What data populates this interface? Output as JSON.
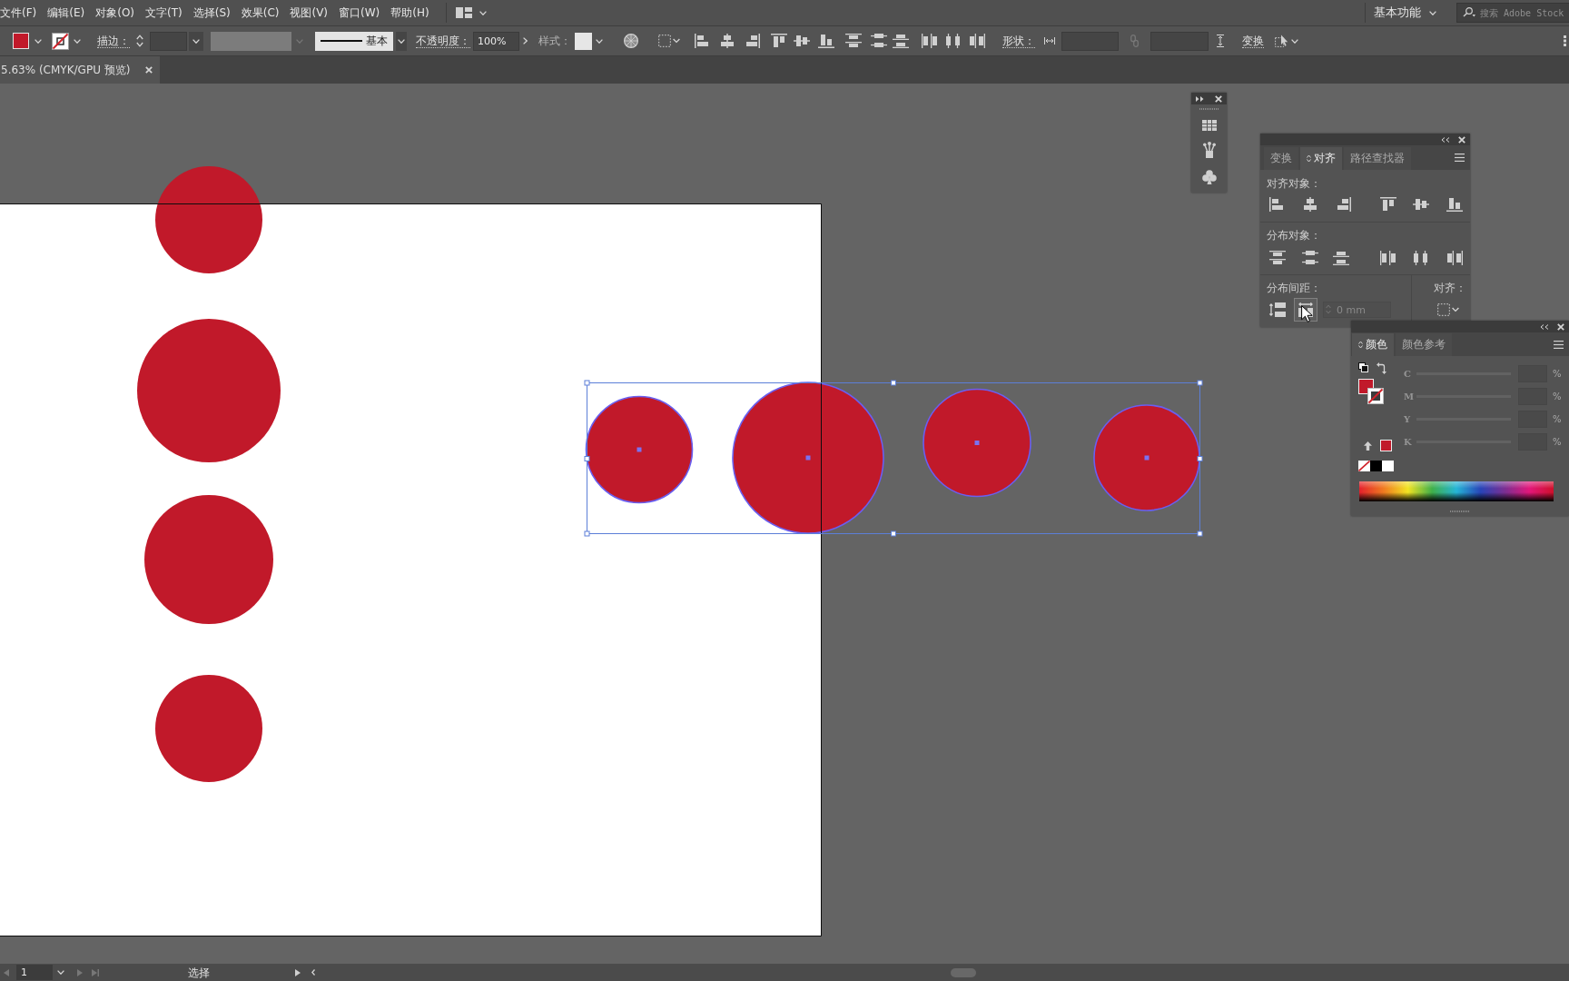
{
  "menu_bar": {
    "items": [
      "文件(F)",
      "编辑(E)",
      "对象(O)",
      "文字(T)",
      "选择(S)",
      "效果(C)",
      "视图(V)",
      "窗口(W)",
      "帮助(H)"
    ],
    "workspace": "基本功能",
    "search": {
      "placeholder": "搜索 Adobe Stock"
    }
  },
  "control_bar": {
    "stroke_label": "描边：",
    "brush": "基本",
    "opacity_label": "不透明度：",
    "opacity": "100%",
    "style_label": "样式：",
    "shape_label": "形状：",
    "transform_label": "变换"
  },
  "document_tab": {
    "title": "5.63% (CMYK/GPU 预览)"
  },
  "canvas": {
    "objects": [
      {
        "selected": false
      },
      {
        "selected": false
      },
      {
        "selected": false
      },
      {
        "selected": false
      },
      {
        "selected": true
      },
      {
        "selected": true
      },
      {
        "selected": true
      },
      {
        "selected": true
      }
    ]
  },
  "align_panel": {
    "tabs": [
      {
        "label": "变换",
        "selected": false
      },
      {
        "label": "对齐",
        "selected": true
      },
      {
        "label": "路径查找器",
        "selected": false
      }
    ],
    "align_objects_label": "对齐对象：",
    "distribute_objects_label": "分布对象：",
    "distribute_spacing_label": "分布间距：",
    "align_to_label": "对齐：",
    "spacing_buttons": [
      {
        "highlighted": false
      },
      {
        "highlighted": true
      }
    ],
    "spacing_field": {
      "value": "0 mm",
      "disabled": true
    }
  },
  "color_panel": {
    "tabs": [
      {
        "label": "颜色",
        "selected": true
      },
      {
        "label": "颜色参考",
        "selected": false
      }
    ],
    "channels": [
      {
        "name": "C",
        "unit": "%",
        "disabled": true
      },
      {
        "name": "M",
        "unit": "%",
        "disabled": true
      },
      {
        "name": "Y",
        "unit": "%",
        "disabled": true
      },
      {
        "name": "K",
        "unit": "%",
        "disabled": true
      }
    ]
  },
  "status_bar": {
    "artboard": "1",
    "tool": "选择"
  }
}
